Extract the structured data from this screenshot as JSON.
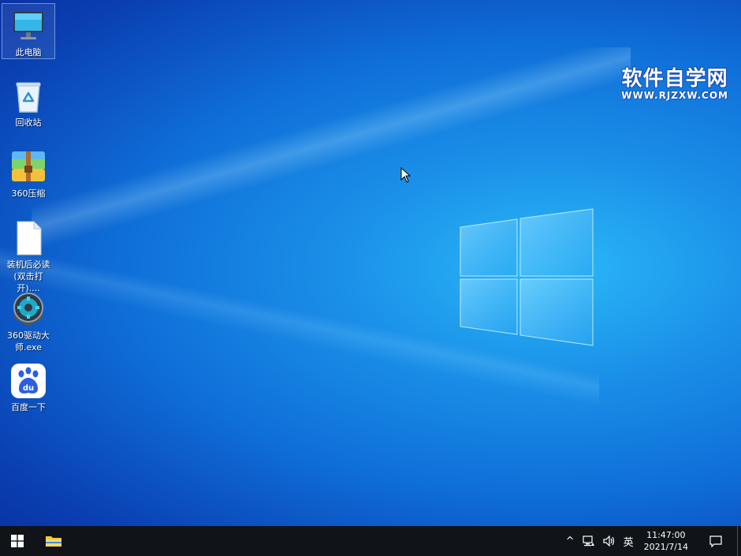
{
  "desktop": {
    "watermark": {
      "main": "软件自学网",
      "sub": "WWW.RJZXW.COM"
    },
    "icons": [
      {
        "label": "此电脑",
        "icon": "computer-icon"
      },
      {
        "label": "回收站",
        "icon": "recycle-bin-icon"
      },
      {
        "label": "360压缩",
        "icon": "archive-icon"
      },
      {
        "label": "装机后必读(双击打开)....",
        "icon": "document-icon"
      },
      {
        "label": "360驱动大师.exe",
        "icon": "gear-icon"
      },
      {
        "label": "百度一下",
        "icon": "baidu-icon"
      }
    ]
  },
  "taskbar": {
    "start": "start-icon",
    "pinned": [
      "file-explorer-icon"
    ],
    "tray": {
      "chevron": "^",
      "language": "英",
      "time": "11:47:00",
      "date": "2021/7/14"
    }
  },
  "colors": {
    "desktop_accent": "#1a8fe8",
    "taskbar_bg": "#101318"
  }
}
